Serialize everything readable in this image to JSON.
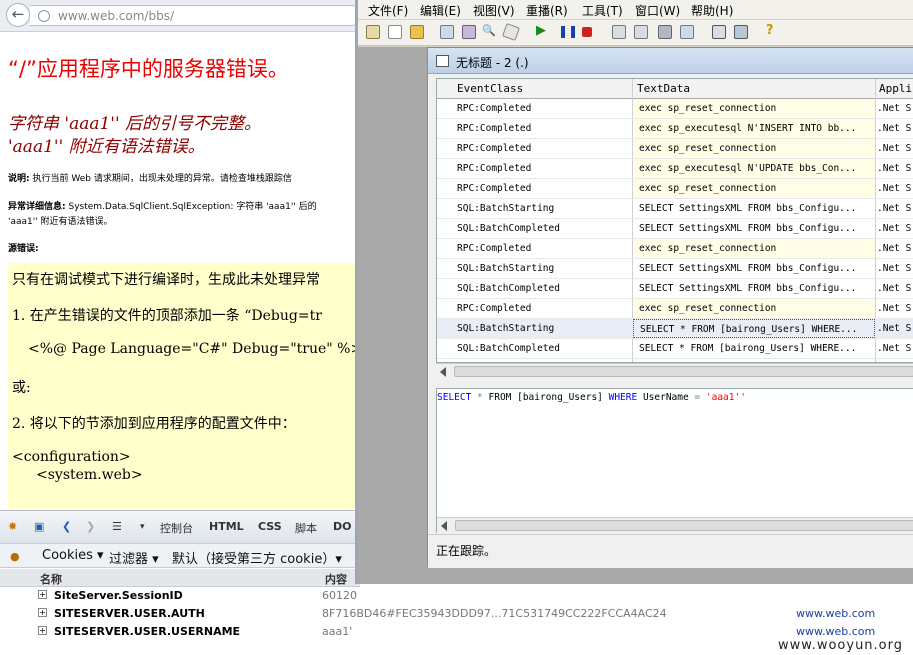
{
  "browser": {
    "url": "www.web.com/bbs/",
    "error_title": "“/”应用程序中的服务器错误。",
    "error_sub1": "字符串 'aaa1'' 后的引号不完整。",
    "error_sub2": "'aaa1'' 附近有语法错误。",
    "desc_label": "说明:",
    "desc_text": "执行当前 Web 请求期间，出现未处理的异常。请检查堆栈跟踪信",
    "ex_label": "异常详细信息:",
    "ex_text": "System.Data.SqlClient.SqlException: 字符串 'aaa1'' 后的",
    "ex_text2": "'aaa1'' 附近有语法错误。",
    "src_label": "源错误:",
    "src_lines": [
      "只有在调试模式下进行编译时，生成此未处理异常",
      "1. 在产生错误的文件的顶部添加一条 “Debug=tr",
      "<%@ Page Language=\"C#\" Debug=\"true\" %>",
      "或:",
      "2. 将以下的节添加到应用程序的配置文件中：",
      "<configuration>",
      "<system.web>"
    ]
  },
  "firebug": {
    "tabs": [
      "控制台",
      "HTML",
      "CSS",
      "脚本",
      "DO"
    ],
    "cookies_menu": "Cookies ▾",
    "filter_menu": "过滤器 ▾",
    "default_menu": "默认（接受第三方 cookie）▾",
    "col_name": "名称",
    "col_content": "内容",
    "cookies": [
      {
        "name": "SiteServer.SessionID",
        "value": "60120",
        "domain": ""
      },
      {
        "name": "SITESERVER.USER.AUTH",
        "value": "8F716BD46#FEC35943DDD97...71C531749CC222FCCA4AC24",
        "domain": "www.web.com"
      },
      {
        "name": "SITESERVER.USER.USERNAME",
        "value": "aaa1'",
        "domain": "www.web.com"
      }
    ]
  },
  "profiler": {
    "menus": [
      "文件(F)",
      "编辑(E)",
      "视图(V)",
      "重播(R)",
      "工具(T)",
      "窗口(W)",
      "帮助(H)"
    ],
    "trace_title": "无标题 - 2 (.)",
    "columns": [
      "EventClass",
      "TextData",
      "Applic"
    ],
    "rows": [
      {
        "event": "RPC:Completed",
        "text": "exec sp_reset_connection",
        "app": ".Net S"
      },
      {
        "event": "RPC:Completed",
        "text": "exec sp_executesql N'INSERT INTO bb...",
        "app": ".Net S"
      },
      {
        "event": "RPC:Completed",
        "text": "exec sp_reset_connection",
        "app": ".Net S"
      },
      {
        "event": "RPC:Completed",
        "text": "exec sp_executesql N'UPDATE bbs_Con...",
        "app": ".Net S"
      },
      {
        "event": "RPC:Completed",
        "text": "exec sp_reset_connection",
        "app": ".Net S"
      },
      {
        "event": "SQL:BatchStarting",
        "text": "SELECT SettingsXML FROM bbs_Configu...",
        "app": ".Net S"
      },
      {
        "event": "SQL:BatchCompleted",
        "text": "SELECT SettingsXML FROM bbs_Configu...",
        "app": ".Net S"
      },
      {
        "event": "RPC:Completed",
        "text": "exec sp_reset_connection",
        "app": ".Net S"
      },
      {
        "event": "SQL:BatchStarting",
        "text": "SELECT SettingsXML FROM bbs_Configu...",
        "app": ".Net S"
      },
      {
        "event": "SQL:BatchCompleted",
        "text": "SELECT SettingsXML FROM bbs_Configu...",
        "app": ".Net S"
      },
      {
        "event": "RPC:Completed",
        "text": "exec sp_reset_connection",
        "app": ".Net S"
      },
      {
        "event": "SQL:BatchStarting",
        "text": "SELECT * FROM [bairong_Users] WHERE...",
        "app": ".Net S"
      },
      {
        "event": "SQL:BatchCompleted",
        "text": "SELECT * FROM [bairong_Users] WHERE...",
        "app": ".Net S"
      }
    ],
    "detail": {
      "kw1": "SELECT",
      "star": " * ",
      "mid": "FROM [bairong_Users] ",
      "kw2": "WHERE",
      "col": " UserName ",
      "eq": "=",
      "str": " 'aaa1''"
    },
    "status": "正在跟踪。"
  },
  "watermark": "www.wooyun.org",
  "colors": {
    "error_red": "#e00000",
    "dark_red": "#8b0000",
    "source_bg": "#ffffcc",
    "rpc_bg": "#fffde6"
  }
}
